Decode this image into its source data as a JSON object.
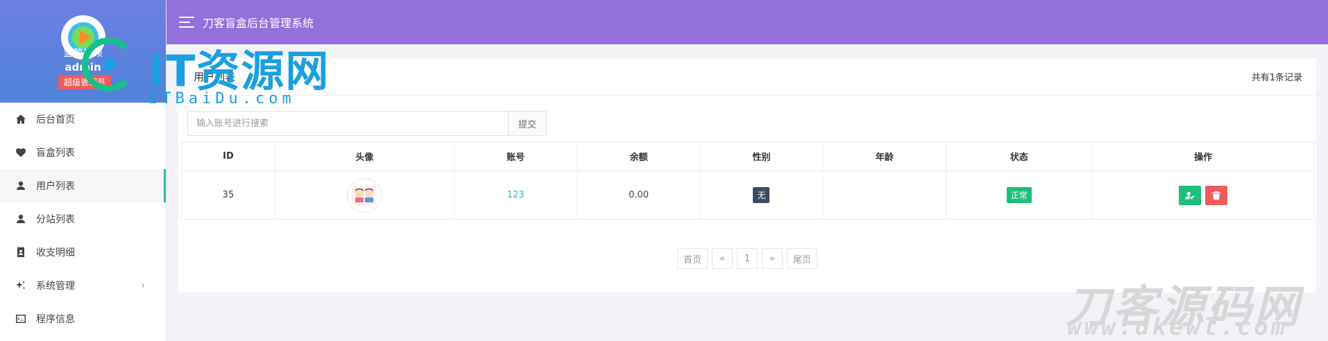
{
  "sidebar": {
    "site_name": "蓝鲸视频",
    "admin_name": "admin",
    "role": "超级管理员",
    "items": [
      {
        "label": "后台首页",
        "icon": "home-icon"
      },
      {
        "label": "盲盒列表",
        "icon": "heart-icon"
      },
      {
        "label": "用户列表",
        "icon": "user-icon",
        "active": true
      },
      {
        "label": "分站列表",
        "icon": "user-icon"
      },
      {
        "label": "收支明细",
        "icon": "contacts-book-icon"
      },
      {
        "label": "系统管理",
        "icon": "sparkle-icon",
        "caret": "›"
      },
      {
        "label": "程序信息",
        "icon": "terminal-icon"
      }
    ]
  },
  "header": {
    "title": "刀客盲盒后台管理系统"
  },
  "card": {
    "title": "用户列表",
    "record_count": "共有1条记录"
  },
  "search": {
    "placeholder": "输入账号进行搜索",
    "value": "",
    "submit_label": "提交"
  },
  "table": {
    "columns": [
      "ID",
      "头像",
      "账号",
      "余额",
      "性别",
      "年龄",
      "状态",
      "操作"
    ],
    "rows": [
      {
        "id": "35",
        "account": "123",
        "balance": "0.00",
        "gender": "无",
        "age": "",
        "status": "正常"
      }
    ]
  },
  "pagination": {
    "first": "首页",
    "prev": "«",
    "current": "1",
    "next": "»",
    "last": "尾页"
  },
  "watermarks": {
    "left_big": "IT资源网",
    "left_small": "ITBaiDu.com",
    "right_big": "刀客源码网",
    "right_small": "www.dkewl.com"
  },
  "colors": {
    "topbar": "#9370db",
    "active_border": "#2ab7b0",
    "success": "#1dbe7a",
    "danger": "#f25b5b",
    "link": "#2db7c7"
  }
}
